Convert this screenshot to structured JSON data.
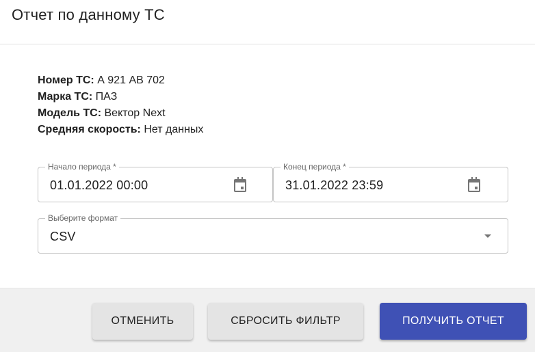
{
  "dialog": {
    "title": "Отчет по данному ТС"
  },
  "vehicle": {
    "number_key": "Номер ТС:",
    "number_value": "А 921 АВ 702",
    "brand_key": "Марка ТС:",
    "brand_value": "ПАЗ",
    "model_key": "Модель ТС:",
    "model_value": "Вектор Next",
    "speed_key": "Средняя скорость:",
    "speed_value": "Нет данных"
  },
  "period": {
    "start_label": "Начало периода *",
    "start_value": "01.01.2022 00:00",
    "end_label": "Конец периода *",
    "end_value": "31.01.2022 23:59",
    "icon": "calendar-icon"
  },
  "format": {
    "label": "Выберите формат",
    "value": "CSV",
    "icon": "dropdown-arrow-icon"
  },
  "actions": {
    "cancel": "ОТМЕНИТЬ",
    "reset": "СБРОСИТЬ ФИЛЬТР",
    "get_report": "ПОЛУЧИТЬ ОТЧЕТ"
  },
  "colors": {
    "primary": "#3f51b5",
    "secondary_button": "#e4e4e4",
    "footer_bg": "#f0f0f0",
    "border": "#c4c4c4"
  }
}
